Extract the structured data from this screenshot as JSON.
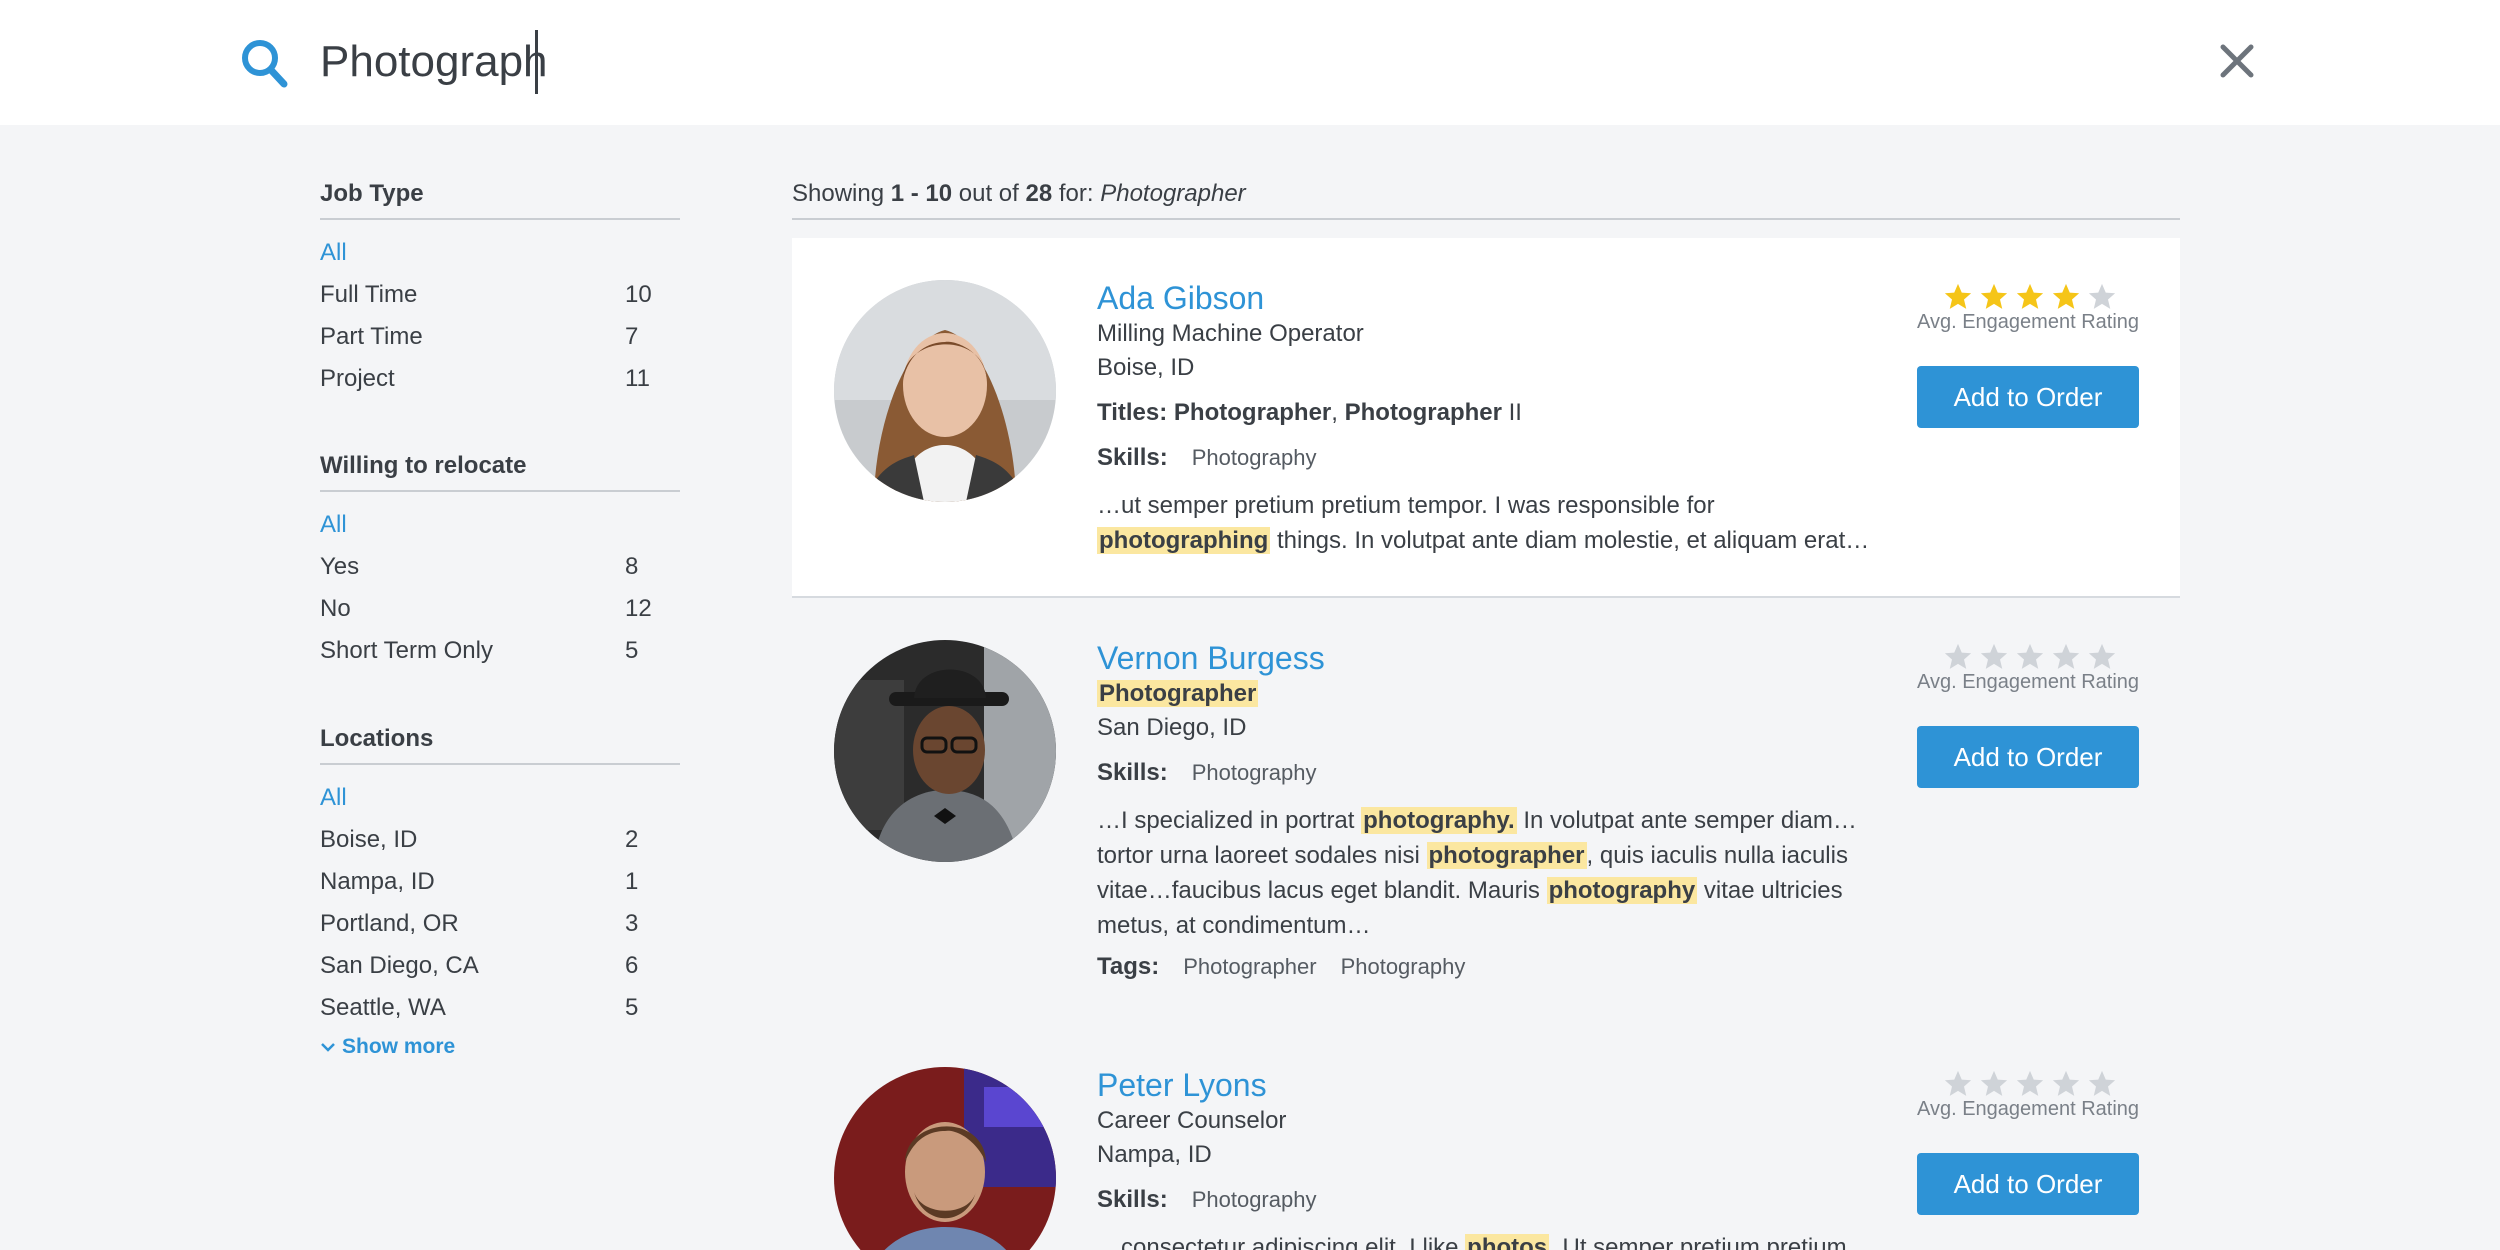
{
  "search": {
    "value": "Photograph"
  },
  "sidebar": {
    "job_type": {
      "title": "Job Type",
      "all": "All",
      "options": [
        {
          "label": "Full Time",
          "count": "10"
        },
        {
          "label": "Part Time",
          "count": "7"
        },
        {
          "label": "Project",
          "count": "11"
        }
      ]
    },
    "relocate": {
      "title": "Willing to relocate",
      "all": "All",
      "options": [
        {
          "label": "Yes",
          "count": "8"
        },
        {
          "label": "No",
          "count": "12"
        },
        {
          "label": "Short Term Only",
          "count": "5"
        }
      ]
    },
    "locations": {
      "title": "Locations",
      "all": "All",
      "options": [
        {
          "label": "Boise, ID",
          "count": "2"
        },
        {
          "label": "Nampa, ID",
          "count": "1"
        },
        {
          "label": "Portland, OR",
          "count": "3"
        },
        {
          "label": "San Diego, CA",
          "count": "6"
        },
        {
          "label": "Seattle, WA",
          "count": "5"
        }
      ],
      "show_more": "Show more"
    }
  },
  "summary": {
    "prefix": "Showing ",
    "range": "1 - 10",
    "middle": " out of ",
    "total": "28",
    "for": " for: ",
    "query": "Photographer"
  },
  "results": [
    {
      "name": "Ada Gibson",
      "title": "Milling Machine Operator",
      "location": "Boise, ID",
      "titles_label": "Titles:",
      "titles_1": "Photographer",
      "titles_sep": ", ",
      "titles_2": "Photographer",
      "titles_2_suffix": " II",
      "skills_label": "Skills:",
      "skill": "Photography",
      "snippet_a": "…ut semper pretium pretium tempor. I was responsible for ",
      "snippet_hl": "photographing",
      "snippet_b": " things. In volutpat ante diam molestie, et aliquam erat…",
      "rating": 4,
      "rating_label": "Avg. Engagement Rating",
      "button": "Add to Order"
    },
    {
      "name": "Vernon Burgess",
      "title": "Photographer",
      "location": "San Diego, ID",
      "skills_label": "Skills:",
      "skill": "Photography",
      "snippet_a": "…I specialized in portrat ",
      "snippet_hl1": "photography.",
      "snippet_b": " In volutpat ante semper diam…tortor urna laoreet sodales nisi ",
      "snippet_hl2": "photographer",
      "snippet_c": ", quis iaculis nulla iaculis vitae…faucibus lacus eget blandit. Mauris ",
      "snippet_hl3": "photography",
      "snippet_d": " vitae ultricies metus, at condimentum…",
      "tags_label": "Tags:",
      "tag_1": "Photographer",
      "tag_2": "Photography",
      "rating": 0,
      "rating_label": "Avg. Engagement Rating",
      "button": "Add to Order"
    },
    {
      "name": "Peter Lyons",
      "title": "Career Counselor",
      "location": "Nampa, ID",
      "skills_label": "Skills:",
      "skill": "Photography",
      "snippet_a": "…consectetur adipiscing elit. I like ",
      "snippet_hl": "photos",
      "snippet_b": ". Ut semper pretium pretium",
      "rating": 0,
      "rating_label": "Avg. Engagement Rating",
      "button": "Add to Order"
    }
  ],
  "colors": {
    "accent": "#2e93d6",
    "star_on": "#f5c518",
    "star_off": "#cfd3d8",
    "highlight": "#fbe7a0"
  }
}
